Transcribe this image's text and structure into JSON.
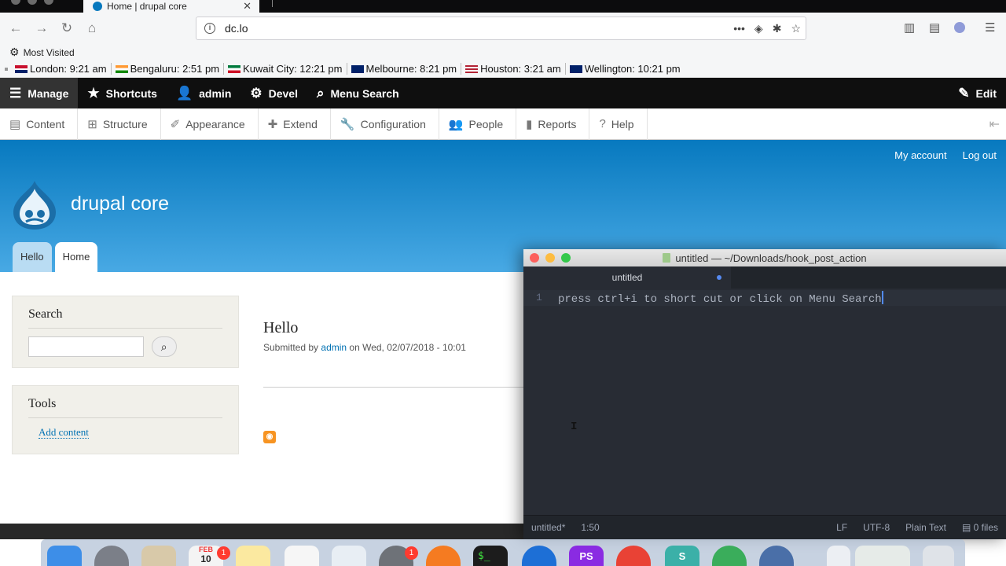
{
  "browser": {
    "tab_title": "Home | drupal core",
    "url": "dc.lo",
    "bookmark_label": "Most Visited",
    "clocks": [
      {
        "label": "London: 9:21 am",
        "flag": "uk"
      },
      {
        "label": "Bengaluru: 2:51 pm",
        "flag": "in"
      },
      {
        "label": "Kuwait City: 12:21 pm",
        "flag": "kw"
      },
      {
        "label": "Melbourne: 8:21 pm",
        "flag": "au"
      },
      {
        "label": "Houston: 3:21 am",
        "flag": "us"
      },
      {
        "label": "Wellington: 10:21 pm",
        "flag": "nz"
      }
    ]
  },
  "toolbar": {
    "manage": "Manage",
    "shortcuts": "Shortcuts",
    "user": "admin",
    "devel": "Devel",
    "menu_search": "Menu Search",
    "edit": "Edit"
  },
  "tray": {
    "items": [
      "Content",
      "Structure",
      "Appearance",
      "Extend",
      "Configuration",
      "People",
      "Reports",
      "Help"
    ]
  },
  "site": {
    "name": "drupal core",
    "my_account": "My account",
    "logout": "Log out",
    "tabs": [
      "Hello",
      "Home"
    ]
  },
  "sidebar": {
    "search_title": "Search",
    "tools_title": "Tools",
    "add_content": "Add content"
  },
  "node": {
    "title": "Hello",
    "submitted_prefix": "Submitted by",
    "author": "admin",
    "submitted_suffix": "on Wed, 02/07/2018 - 10:01"
  },
  "editor": {
    "window_title": "untitled — ~/Downloads/hook_post_action",
    "tab_label": "untitled",
    "line_number": "1",
    "code_text": "press ctrl+i to short cut or click on Menu Search",
    "status_file": "untitled*",
    "status_position": "1:50",
    "status_eol": "LF",
    "status_encoding": "UTF-8",
    "status_grammar": "Plain Text",
    "status_files": "0 files"
  },
  "dock": {
    "calendar_badge": "1",
    "sysprefs_badge": "1",
    "calendar_month": "FEB",
    "calendar_day": "10"
  },
  "colors": {
    "drupal_blue": "#0779bf",
    "toolbar_black": "#0f0f0f",
    "editor_bg": "#282c34",
    "link_blue": "#0071b3"
  }
}
